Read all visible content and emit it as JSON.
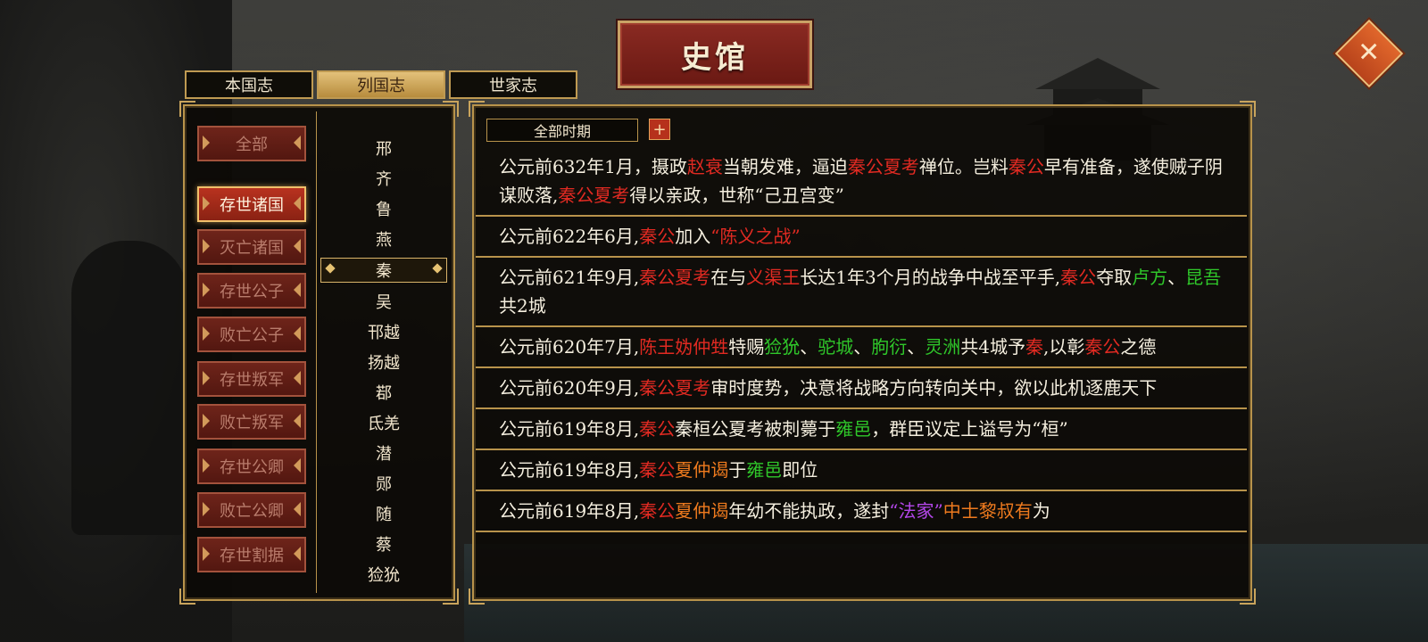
{
  "title": "史馆",
  "tabs": [
    "本国志",
    "列国志",
    "世家志"
  ],
  "active_tab": 1,
  "categories": [
    "全部",
    "存世诸国",
    "灭亡诸国",
    "存世公子",
    "败亡公子",
    "存世叛军",
    "败亡叛军",
    "存世公卿",
    "败亡公卿",
    "存世割据"
  ],
  "selected_category": 1,
  "states": [
    "邢",
    "齐",
    "鲁",
    "燕",
    "秦",
    "吴",
    "邗越",
    "扬越",
    "鄀",
    "氐羌",
    "潜",
    "郧",
    "随",
    "蔡",
    "猃狁"
  ],
  "selected_state": 4,
  "filter": {
    "label": "全部时期",
    "add_label": "+"
  },
  "colors": {
    "person": "#e12a22",
    "place": "#2fc72a",
    "title": "#ee7a1e",
    "school": "#b447ea"
  },
  "events": [
    [
      {
        "t": "公元前632年1月，摄政"
      },
      {
        "t": "赵衰",
        "c": "red"
      },
      {
        "t": "当朝发难，逼迫"
      },
      {
        "t": "秦公夏考",
        "c": "red"
      },
      {
        "t": "禅位。岂料"
      },
      {
        "t": "秦公",
        "c": "red"
      },
      {
        "t": "早有准备，遂使贼子阴谋败落,"
      },
      {
        "t": "秦公夏考",
        "c": "red"
      },
      {
        "t": "得以亲政，世称“己丑宫变”"
      }
    ],
    [
      {
        "t": "公元前622年6月,"
      },
      {
        "t": "秦公",
        "c": "red"
      },
      {
        "t": "加入"
      },
      {
        "t": "“陈义之战”",
        "c": "red"
      }
    ],
    [
      {
        "t": "公元前621年9月,"
      },
      {
        "t": "秦公夏考",
        "c": "red"
      },
      {
        "t": "在与"
      },
      {
        "t": "义渠王",
        "c": "red"
      },
      {
        "t": "长达1年3个月的战争中战至平手,"
      },
      {
        "t": "秦公",
        "c": "red"
      },
      {
        "t": "夺取"
      },
      {
        "t": "卢方",
        "c": "green"
      },
      {
        "t": "、"
      },
      {
        "t": "昆吾",
        "c": "green"
      },
      {
        "t": "共2城"
      }
    ],
    [
      {
        "t": "公元前620年7月,"
      },
      {
        "t": "陈王妫仲甡",
        "c": "red"
      },
      {
        "t": "特赐"
      },
      {
        "t": "猃狁",
        "c": "green"
      },
      {
        "t": "、"
      },
      {
        "t": "驼城",
        "c": "green"
      },
      {
        "t": "、"
      },
      {
        "t": "朐衍",
        "c": "green"
      },
      {
        "t": "、"
      },
      {
        "t": "灵洲",
        "c": "green"
      },
      {
        "t": "共4城予"
      },
      {
        "t": "秦",
        "c": "red"
      },
      {
        "t": ",以彰"
      },
      {
        "t": "秦公",
        "c": "red"
      },
      {
        "t": "之德"
      }
    ],
    [
      {
        "t": "公元前620年9月,"
      },
      {
        "t": "秦公夏考",
        "c": "red"
      },
      {
        "t": "审时度势，决意将战略方向转向关中，欲以此机逐鹿天下"
      }
    ],
    [
      {
        "t": "公元前619年8月,"
      },
      {
        "t": "秦公",
        "c": "red"
      },
      {
        "t": "秦桓公夏考被刺薨于"
      },
      {
        "t": "雍邑",
        "c": "green"
      },
      {
        "t": "，群臣议定上谥号为“桓”"
      }
    ],
    [
      {
        "t": "公元前619年8月,"
      },
      {
        "t": "秦公",
        "c": "red"
      },
      {
        "t": "夏仲谒",
        "c": "orange"
      },
      {
        "t": "于"
      },
      {
        "t": "雍邑",
        "c": "green"
      },
      {
        "t": "即位"
      }
    ],
    [
      {
        "t": "公元前619年8月,"
      },
      {
        "t": "秦公",
        "c": "red"
      },
      {
        "t": "夏仲谒",
        "c": "orange"
      },
      {
        "t": "年幼不能执政，遂封"
      },
      {
        "t": "“法家”",
        "c": "purple"
      },
      {
        "t": "中士黎叔有",
        "c": "orange"
      },
      {
        "t": "为"
      }
    ]
  ]
}
